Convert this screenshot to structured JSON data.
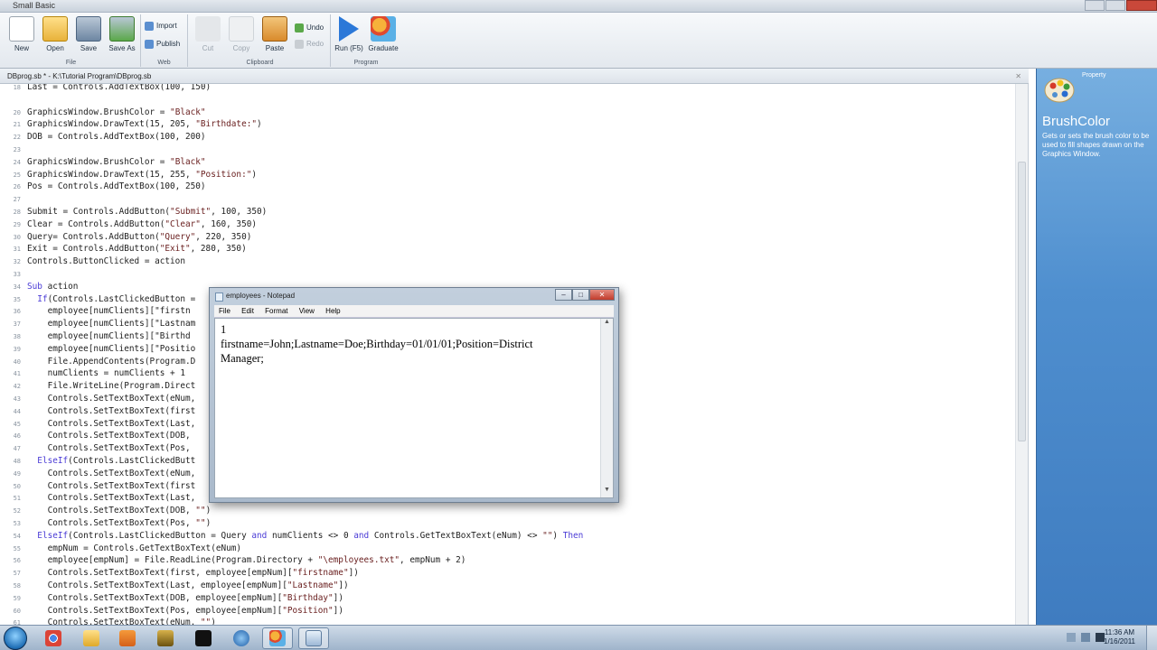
{
  "app": {
    "title": "Small Basic"
  },
  "ribbon": {
    "file_group": {
      "label": "File",
      "buttons": [
        "New",
        "Open",
        "Save",
        "Save As"
      ]
    },
    "web_group": {
      "label": "Web",
      "buttons": [
        "Import",
        "Publish"
      ]
    },
    "clipboard_group": {
      "label": "Clipboard",
      "buttons": [
        "Cut",
        "Copy",
        "Paste",
        "Undo",
        "Redo"
      ]
    },
    "program_group": {
      "label": "Program",
      "buttons": [
        "Run (F5)",
        "Graduate"
      ]
    }
  },
  "document": {
    "tab_label": "DBprog.sb * - K:\\Tutorial Program\\DBprog.sb",
    "close": "✕"
  },
  "code_lines": [
    {
      "n": "18",
      "text": "Last = Controls.AddTextBox(100, 150)"
    },
    {
      "n": "",
      "text": ""
    },
    {
      "n": "20",
      "text": "GraphicsWindow.BrushColor = \"Black\""
    },
    {
      "n": "21",
      "text": "GraphicsWindow.DrawText(15, 205, \"Birthdate:\")"
    },
    {
      "n": "22",
      "text": "DOB = Controls.AddTextBox(100, 200)"
    },
    {
      "n": "23",
      "text": ""
    },
    {
      "n": "24",
      "text": "GraphicsWindow.BrushColor = \"Black\""
    },
    {
      "n": "25",
      "text": "GraphicsWindow.DrawText(15, 255, \"Position:\")"
    },
    {
      "n": "26",
      "text": "Pos = Controls.AddTextBox(100, 250)"
    },
    {
      "n": "27",
      "text": ""
    },
    {
      "n": "28",
      "text": "Submit = Controls.AddButton(\"Submit\", 100, 350)"
    },
    {
      "n": "29",
      "text": "Clear = Controls.AddButton(\"Clear\", 160, 350)"
    },
    {
      "n": "30",
      "text": "Query= Controls.AddButton(\"Query\", 220, 350)"
    },
    {
      "n": "31",
      "text": "Exit = Controls.AddButton(\"Exit\", 280, 350)"
    },
    {
      "n": "32",
      "text": "Controls.ButtonClicked = action"
    },
    {
      "n": "33",
      "text": ""
    },
    {
      "n": "34",
      "text": "Sub action"
    },
    {
      "n": "35",
      "text": "  If(Controls.LastClickedButton = "
    },
    {
      "n": "36",
      "text": "    employee[numClients][\"firstn"
    },
    {
      "n": "37",
      "text": "    employee[numClients][\"Lastnam"
    },
    {
      "n": "38",
      "text": "    employee[numClients][\"Birthd"
    },
    {
      "n": "39",
      "text": "    employee[numClients][\"Positio"
    },
    {
      "n": "40",
      "text": "    File.AppendContents(Program.D"
    },
    {
      "n": "41",
      "text": "    numClients = numClients + 1"
    },
    {
      "n": "42",
      "text": "    File.WriteLine(Program.Direct"
    },
    {
      "n": "43",
      "text": "    Controls.SetTextBoxText(eNum,"
    },
    {
      "n": "44",
      "text": "    Controls.SetTextBoxText(first"
    },
    {
      "n": "45",
      "text": "    Controls.SetTextBoxText(Last,"
    },
    {
      "n": "46",
      "text": "    Controls.SetTextBoxText(DOB,"
    },
    {
      "n": "47",
      "text": "    Controls.SetTextBoxText(Pos,"
    },
    {
      "n": "48",
      "text": "  ElseIf(Controls.LastClickedButt"
    },
    {
      "n": "49",
      "text": "    Controls.SetTextBoxText(eNum,"
    },
    {
      "n": "50",
      "text": "    Controls.SetTextBoxText(first"
    },
    {
      "n": "51",
      "text": "    Controls.SetTextBoxText(Last,"
    },
    {
      "n": "52",
      "text": "    Controls.SetTextBoxText(DOB, \"\")"
    },
    {
      "n": "53",
      "text": "    Controls.SetTextBoxText(Pos, \"\")"
    },
    {
      "n": "54",
      "text": "  ElseIf(Controls.LastClickedButton = Query and numClients <> 0 and Controls.GetTextBoxText(eNum) <> \"\") Then"
    },
    {
      "n": "55",
      "text": "    empNum = Controls.GetTextBoxText(eNum)"
    },
    {
      "n": "56",
      "text": "    employee[empNum] = File.ReadLine(Program.Directory + \"\\employees.txt\", empNum + 2)"
    },
    {
      "n": "57",
      "text": "    Controls.SetTextBoxText(first, employee[empNum][\"firstname\"])"
    },
    {
      "n": "58",
      "text": "    Controls.SetTextBoxText(Last, employee[empNum][\"Lastname\"])"
    },
    {
      "n": "59",
      "text": "    Controls.SetTextBoxText(DOB, employee[empNum][\"Birthday\"])"
    },
    {
      "n": "60",
      "text": "    Controls.SetTextBoxText(Pos, employee[empNum][\"Position\"])"
    },
    {
      "n": "61",
      "text": "    Controls.SetTextBoxText(eNum, \"\")"
    }
  ],
  "property_panel": {
    "header": "Property",
    "name": "BrushColor",
    "description": "Gets or sets the brush color to be used to fill shapes drawn on the Graphics Window."
  },
  "notepad": {
    "title": "employees - Notepad",
    "menu": [
      "File",
      "Edit",
      "Format",
      "View",
      "Help"
    ],
    "content": "1\nfirstname=John;Lastname=Doe;Birthday=01/01/01;Position=District\nManager;"
  },
  "taskbar": {
    "time": "11:36 AM",
    "date": "1/16/2011",
    "apps": [
      "chrome-icon",
      "explorer-icon",
      "media-player-icon",
      "winamp-icon",
      "terminal-icon",
      "globe-icon",
      "small-basic-icon",
      "notepad-icon"
    ]
  },
  "colors": {
    "accent": "#4f8fcf",
    "keyword": "#4a3bd6",
    "string": "#6a2020"
  }
}
